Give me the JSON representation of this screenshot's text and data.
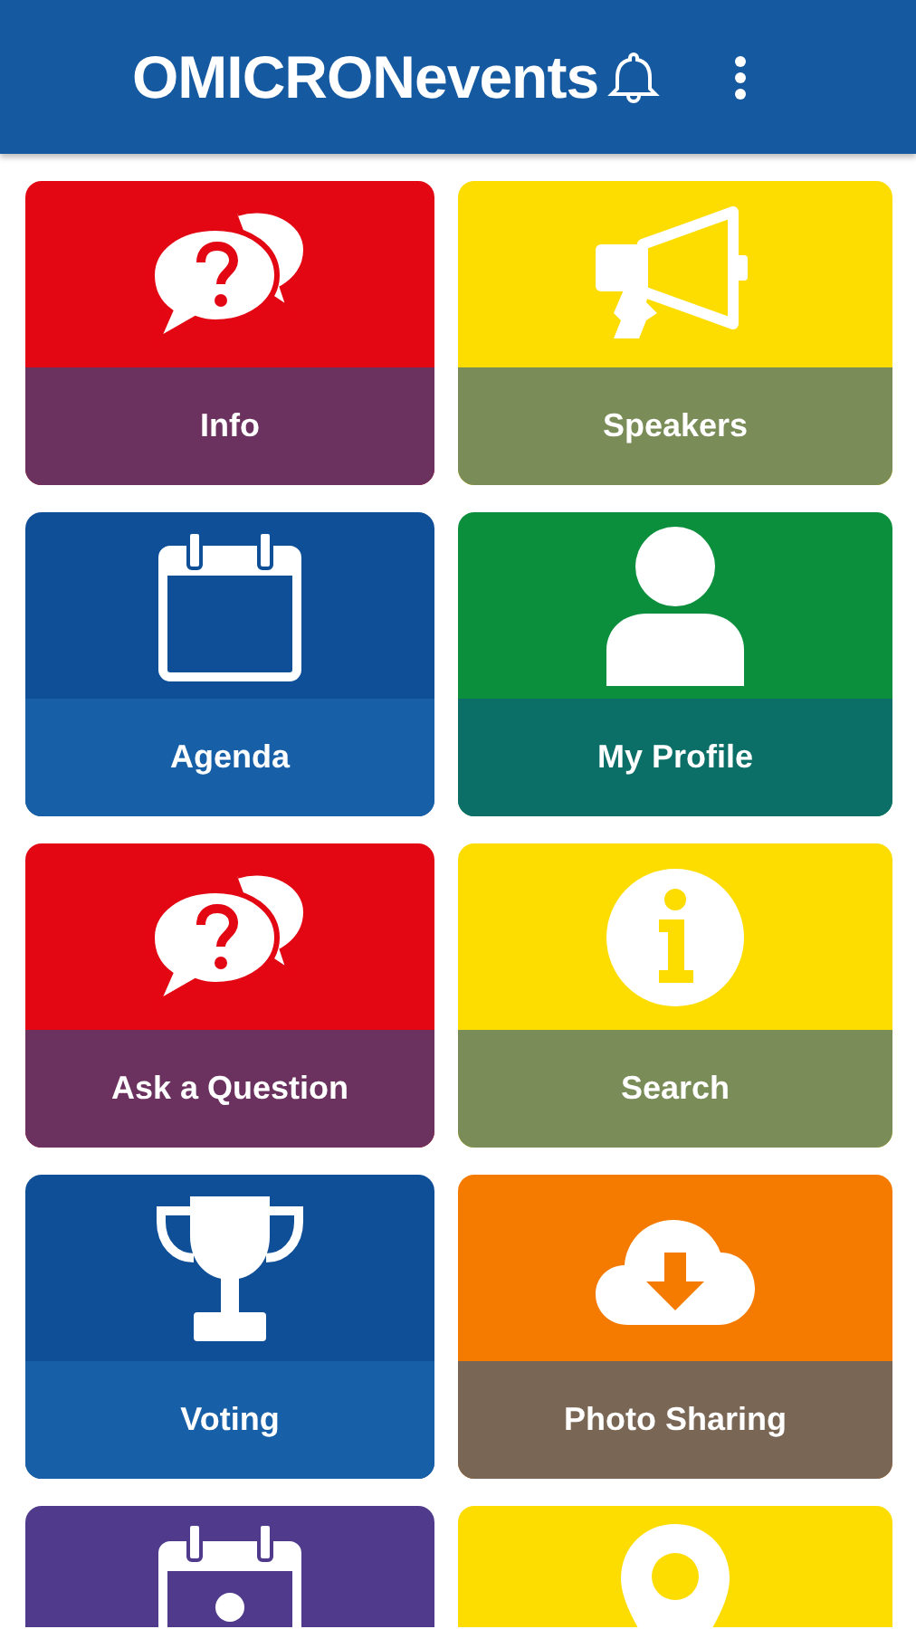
{
  "app_bar": {
    "title": "OMICRONevents"
  },
  "tiles": [
    {
      "kind": "chat-question",
      "color": "#e30613",
      "label": {
        "text": "Info",
        "color": "#6b3260"
      }
    },
    {
      "kind": "megaphone",
      "color": "#fddc00",
      "label": {
        "text": "Speakers",
        "color": "#7a8c58"
      }
    },
    {
      "kind": "calendar",
      "color": "#0f4f97",
      "label": {
        "text": "Agenda",
        "color": "#1760a8"
      }
    },
    {
      "kind": "person",
      "color": "#0b8f3c",
      "label": {
        "text": "My Profile",
        "color": "#0b6e67"
      }
    },
    {
      "kind": "chat-question",
      "color": "#e30613",
      "label": {
        "text": "Ask a Question",
        "color": "#6b3260"
      }
    },
    {
      "kind": "info",
      "color": "#fddc00",
      "label": {
        "text": "Search",
        "color": "#7a8c58"
      }
    },
    {
      "kind": "trophy",
      "color": "#0f4f97",
      "label": {
        "text": "Voting",
        "color": "#1760a8"
      }
    },
    {
      "kind": "cloud-download",
      "color": "#f47a00",
      "label": {
        "text": "Photo Sharing",
        "color": "#7a6655"
      }
    },
    {
      "kind": "calendar-person",
      "color": "#4f3a8c"
    },
    {
      "kind": "map-pin",
      "color": "#fddc00"
    }
  ]
}
